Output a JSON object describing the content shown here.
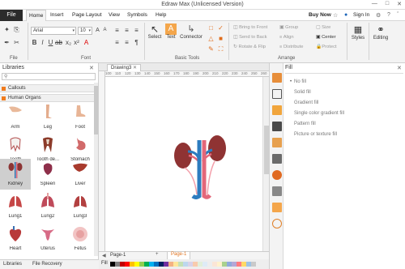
{
  "app": {
    "title": "Edraw Max (Unlicensed Version)"
  },
  "menu": {
    "file": "File",
    "tabs": [
      "Home",
      "Insert",
      "Page Layout",
      "View",
      "Symbols",
      "Help"
    ],
    "buy_now": "Buy Now",
    "sign_in": "Sign In"
  },
  "ribbon": {
    "font_name": "Arial",
    "font_size": "10",
    "groups": {
      "file": "File",
      "font": "Font",
      "basic_tools": "Basic Tools",
      "arrange": "Arrange"
    },
    "select": "Select",
    "text": "Text",
    "connector": "Connector",
    "bring_to_front": "Bring to Front",
    "send_to_back": "Send to Back",
    "rotate_flip": "Rotate & Flip",
    "group": "Group",
    "align": "Align",
    "distribute": "Distribute",
    "size": "Size",
    "center": "Center",
    "protect": "Protect",
    "styles": "Styles",
    "editing": "Editing"
  },
  "libraries": {
    "title": "Libraries",
    "categories": [
      "Callouts",
      "Human Organs"
    ],
    "items": [
      {
        "label": "Arm"
      },
      {
        "label": "Leg"
      },
      {
        "label": "Foot"
      },
      {
        "label": "Teeth"
      },
      {
        "label": "Tooth de..."
      },
      {
        "label": "Stomach"
      },
      {
        "label": "Kidney"
      },
      {
        "label": "Spleen"
      },
      {
        "label": "Liver"
      },
      {
        "label": "Lung1"
      },
      {
        "label": "Lung2"
      },
      {
        "label": "Lung3"
      },
      {
        "label": "Heart"
      },
      {
        "label": "Uterus"
      },
      {
        "label": "Fetus"
      }
    ],
    "bottom_tabs": [
      "Libraries",
      "File Recovery"
    ]
  },
  "document": {
    "tab": "Drawing3",
    "ruler_marks": [
      "100",
      "110",
      "120",
      "130",
      "140",
      "150",
      "160",
      "170",
      "180",
      "190",
      "200",
      "210",
      "220",
      "230",
      "240",
      "250",
      "260"
    ],
    "page_tab_left": "Page-1",
    "page_tab_active": "Page-1",
    "fill_label": "Fill"
  },
  "fill_panel": {
    "title": "Fill",
    "options": [
      "No fill",
      "Solid fill",
      "Gradient fill",
      "Single color gradient fill",
      "Pattern fill",
      "Picture or texture fill"
    ],
    "selected": "No fill"
  },
  "colors": {
    "file_tab": "#2b2b2b",
    "accent_orange": "#f07c1e",
    "palette": [
      "#000000",
      "#7f7f7f",
      "#c00000",
      "#ff0000",
      "#ffc000",
      "#ffff00",
      "#92d050",
      "#00b050",
      "#00b0f0",
      "#0070c0",
      "#002060",
      "#7030a0",
      "#f4b183",
      "#ffe699",
      "#c5e0b4",
      "#bdd7ee",
      "#d9d2e9",
      "#f8cbad",
      "#e2efd9",
      "#deebf6",
      "#ededed",
      "#fbe5d6",
      "#fff2cc",
      "#a9d18e",
      "#8faadc",
      "#b4a7d6",
      "#ff7c80",
      "#ffd966",
      "#9dc3e6",
      "#c9c9c9"
    ]
  }
}
